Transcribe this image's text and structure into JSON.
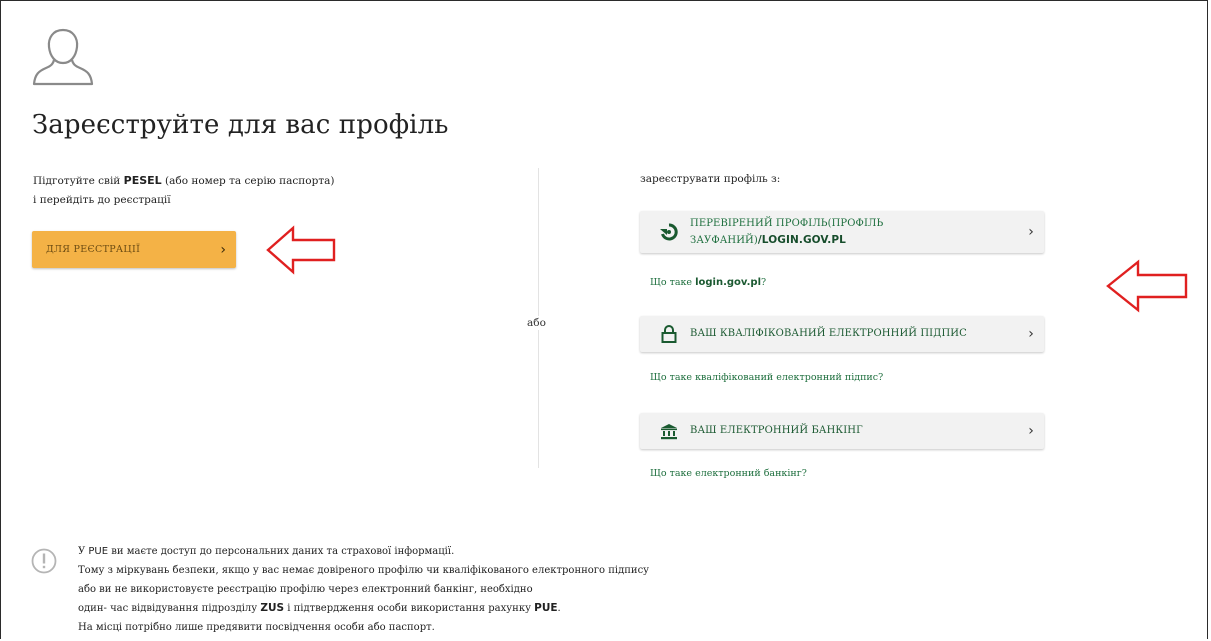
{
  "page": {
    "title": "Зареєструйте для вас профіль"
  },
  "left": {
    "line1_pre": "Підготуйте свій ",
    "line1_bold": "PESEL",
    "line1_post": " (або номер та серію паспорта)",
    "line2": "і перейдіть до реєстрації",
    "register_button": "ДЛЯ РЕЄСТРАЦІЇ",
    "register_chevron": "›"
  },
  "or_label": "або",
  "right": {
    "heading": "зареєструвати профіль з:",
    "options": [
      {
        "label_pre": "ПЕРЕВІРЕНИЙ ПРОФІЛЬ(ПРОФІЛЬ",
        "label_line2_pre": "ЗАУФАНИЙ)",
        "label_line2_bold": "/LOGIN.GOV.PL",
        "icon": "login-gov-icon",
        "chevron": "›"
      },
      {
        "label": "ВАШ КВАЛІФІКОВАНИЙ ЕЛЕКТРОННИЙ ПІДПИС",
        "icon": "lock-icon",
        "chevron": "›"
      },
      {
        "label": "ВАШ ЕЛЕКТРОННИЙ БАНКІНГ",
        "icon": "bank-icon",
        "chevron": "›"
      }
    ],
    "links": [
      {
        "pre": "Що таке ",
        "bold": "login.gov.pl",
        "post": "?"
      },
      {
        "pre": "Що таке кваліфікований електронний підпис",
        "bold": "",
        "post": "?"
      },
      {
        "pre": "Що таке електронний банкінг",
        "bold": "",
        "post": "?"
      }
    ]
  },
  "info": {
    "l1_pre": "У ",
    "l1_bold": "PUE",
    "l1_post": " ви маєте доступ до персональних даних та страхової інформації.",
    "l2": "Тому з міркувань безпеки, якщо у вас немає довіреного профілю чи кваліфікованого електронного підпису",
    "l3": "або ви не використовуєте реєстрацію профілю через електронний банкінг, необхідно",
    "l4_pre": "один- час відвідування підрозділу ",
    "l4_bold1": "ZUS",
    "l4_mid": " і підтвердження особи використання рахунку ",
    "l4_bold2": "PUE",
    "l4_post": ".",
    "l5": "На місці потрібно лише предявити посвідчення особи або паспорт."
  },
  "colors": {
    "accent": "#f4b246",
    "green": "#1e6f3e",
    "arrow": "#e02020"
  }
}
